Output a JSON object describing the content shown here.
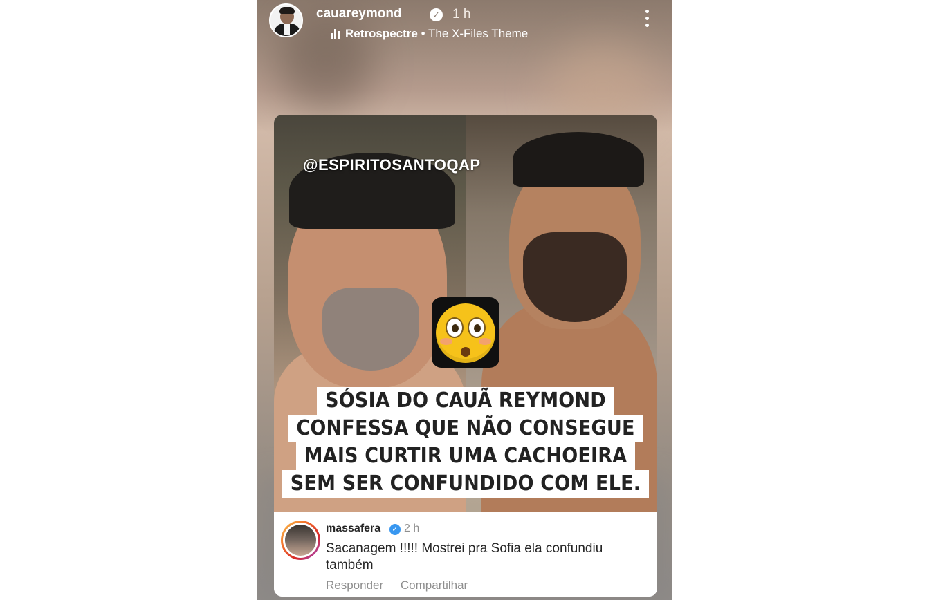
{
  "story": {
    "username": "cauareymond",
    "time": "1 h",
    "music": {
      "artist": "Retrospectre",
      "separator": "•",
      "track": "The X-Files Theme"
    }
  },
  "post": {
    "watermark": "@ESPIRITOSANTOQAP",
    "caption_lines": [
      "SÓSIA DO CAUÃ REYMOND",
      "CONFESSA QUE NÃO CONSEGUE",
      "MAIS CURTIR UMA CACHOEIRA",
      "SEM SER CONFUNDIDO COM ELE."
    ],
    "emoji": "flushed-face-icon"
  },
  "comment": {
    "username": "massafera",
    "time": "2 h",
    "text": "Sacanagem !!!!! Mostrei pra Sofia ela confundiu também",
    "actions": [
      "Responder",
      "Compartilhar"
    ]
  },
  "colors": {
    "comment_verified": "#3897f0",
    "secondary_text": "#8e8e8e"
  }
}
